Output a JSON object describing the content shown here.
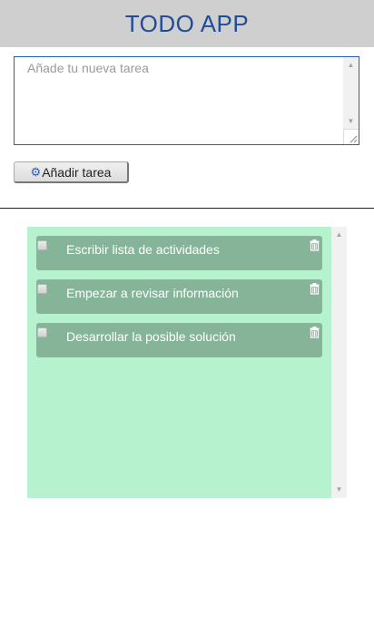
{
  "header": {
    "title": "TODO APP"
  },
  "new_task": {
    "placeholder": "Añade tu nueva tarea",
    "value": ""
  },
  "add_button": {
    "label": "Añadir tarea",
    "icon": "gear-icon"
  },
  "tasks": [
    {
      "label": "Escribir lista de actividades",
      "checked": false
    },
    {
      "label": "Empezar a revisar información",
      "checked": false
    },
    {
      "label": "Desarrollar la posible solución",
      "checked": false
    }
  ],
  "colors": {
    "header_bg": "#cfcfcf",
    "title": "#1f4d99",
    "list_bg": "#b6f2cd",
    "task_bg": "#85b498",
    "task_text": "#ffffff"
  }
}
